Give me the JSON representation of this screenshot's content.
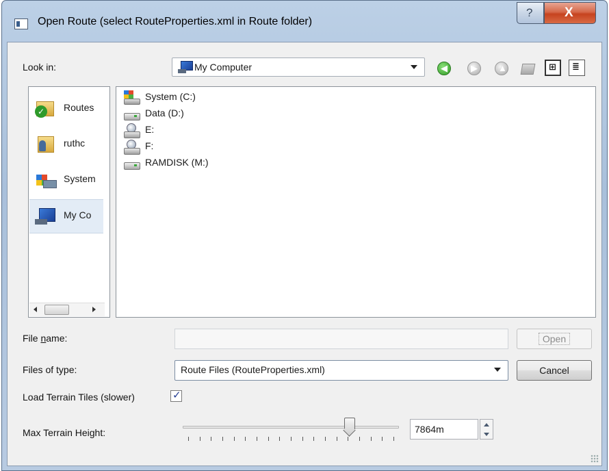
{
  "window": {
    "title": "Open Route (select RouteProperties.xml in Route folder)",
    "help_label": "?",
    "close_label": "X"
  },
  "look_in": {
    "label": "Look in:",
    "value": "My Computer"
  },
  "toolbar": {
    "back_label": "◀",
    "forward_label": "▶",
    "up_label": "▲",
    "list_view_label": "⊞",
    "detail_view_label": "≣"
  },
  "sidebar": {
    "items": [
      {
        "label": "Routes",
        "icon": "folder-check-icon"
      },
      {
        "label": "ruthc",
        "icon": "user-folder-icon"
      },
      {
        "label": "System",
        "icon": "system-icon"
      },
      {
        "label": "My Co",
        "icon": "my-computer-icon"
      }
    ]
  },
  "files": [
    {
      "label": "System (C:)",
      "icon": "system-drive-icon"
    },
    {
      "label": "Data (D:)",
      "icon": "hard-drive-icon"
    },
    {
      "label": "E:",
      "icon": "network-drive-icon"
    },
    {
      "label": "F:",
      "icon": "network-drive-icon"
    },
    {
      "label": "RAMDISK (M:)",
      "icon": "hard-drive-icon"
    }
  ],
  "file_name": {
    "label_pre": "File ",
    "label_u": "n",
    "label_post": "ame:",
    "value": "",
    "open_label": "Open"
  },
  "file_type": {
    "label": "Files of type:",
    "value": "Route Files (RouteProperties.xml)",
    "cancel_label": "Cancel"
  },
  "terrain": {
    "label": "Load Terrain Tiles (slower)",
    "checked": true,
    "check_mark": "✓"
  },
  "max_height": {
    "label": "Max Terrain Height:",
    "value": "7864m",
    "slider_fraction": 0.77
  }
}
